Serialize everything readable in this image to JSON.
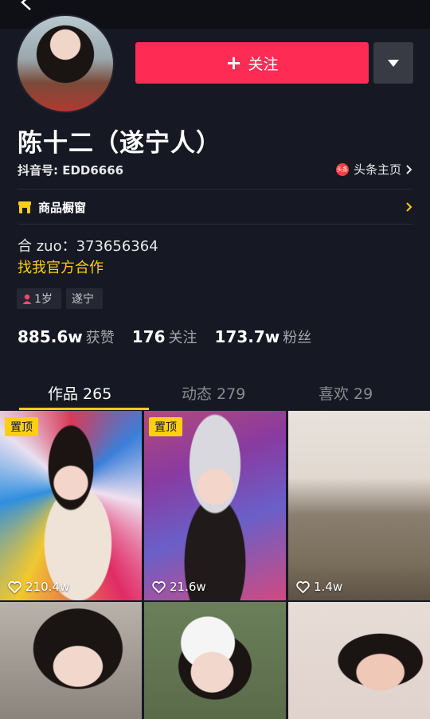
{
  "profile": {
    "name": "陈十二（遂宁人）",
    "douyin_id": "抖音号: EDD6666",
    "toutiao_link": "头条主页",
    "toutiao_badge": "头条"
  },
  "actions": {
    "follow_label": "关注"
  },
  "shop": {
    "label": "商品橱窗"
  },
  "bio": {
    "line1": "合 zuo：373656364",
    "line2": "找我官方合作"
  },
  "tags": {
    "age": "1岁",
    "location": "遂宁"
  },
  "stats": [
    {
      "value": "885.6w",
      "label": "获赞"
    },
    {
      "value": "176",
      "label": "关注"
    },
    {
      "value": "173.7w",
      "label": "粉丝"
    }
  ],
  "tabs": [
    {
      "label": "作品 265",
      "active": true
    },
    {
      "label": "动态 279",
      "active": false
    },
    {
      "label": "喜欢 29",
      "active": false
    }
  ],
  "videos": [
    {
      "pinned": true,
      "pin_label": "置顶",
      "likes": "210.4w"
    },
    {
      "pinned": true,
      "pin_label": "置顶",
      "likes": "21.6w"
    },
    {
      "pinned": false,
      "likes": "1.4w"
    }
  ],
  "colors": {
    "background": "#161823",
    "follow_button": "#fe2c55",
    "accent_yellow": "#face15"
  }
}
